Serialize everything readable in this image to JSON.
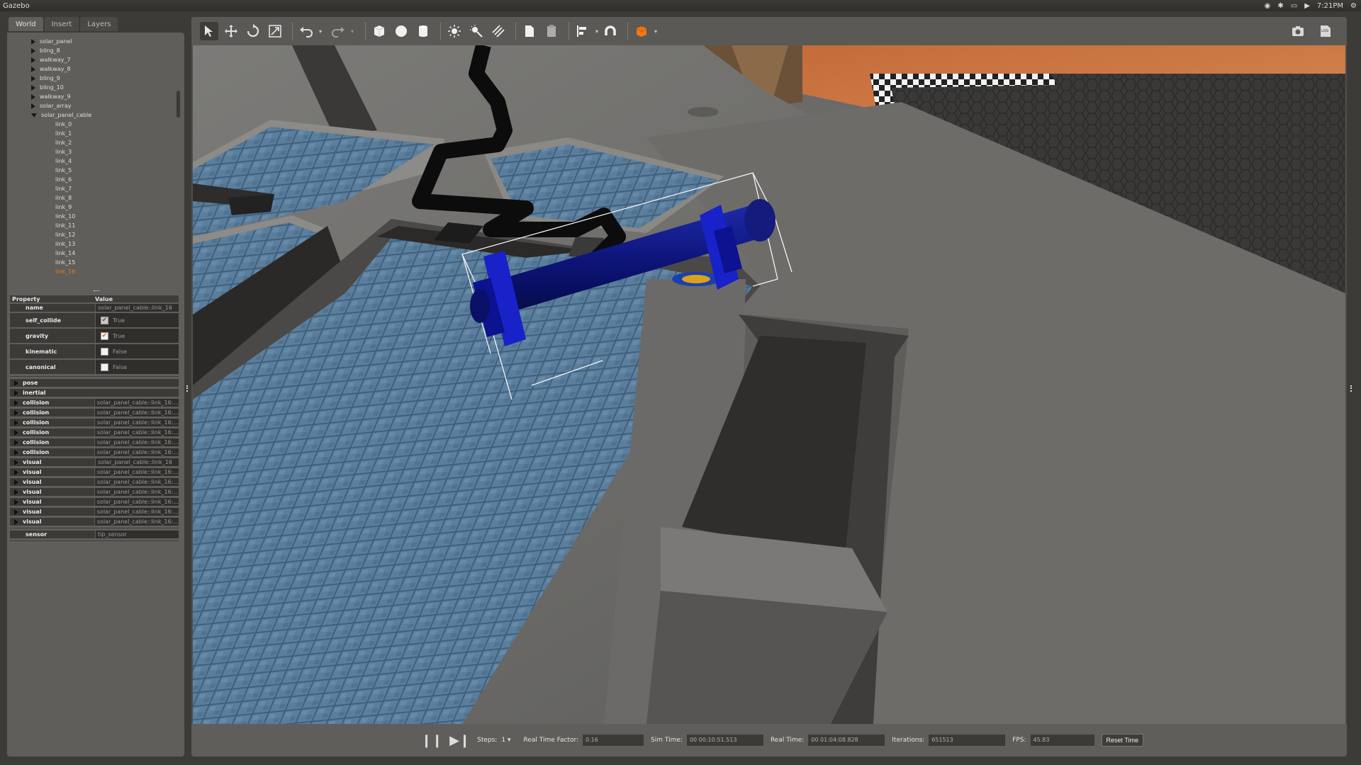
{
  "window": {
    "title": "Gazebo"
  },
  "system_tray": {
    "time": "7:21PM",
    "wifi": "wifi-icon",
    "bluetooth": "bluetooth-icon",
    "battery": "battery-icon",
    "volume": "volume-icon",
    "settings": "gear-icon"
  },
  "left_tabs": [
    {
      "label": "World"
    },
    {
      "label": "Insert"
    },
    {
      "label": "Layers"
    }
  ],
  "tree": {
    "items": [
      {
        "label": "solar_panel",
        "level": 1,
        "expanded": false
      },
      {
        "label": "bling_8",
        "level": 1,
        "expanded": false
      },
      {
        "label": "walkway_7",
        "level": 1,
        "expanded": false
      },
      {
        "label": "walkway_8",
        "level": 1,
        "expanded": false
      },
      {
        "label": "bling_9",
        "level": 1,
        "expanded": false
      },
      {
        "label": "bling_10",
        "level": 1,
        "expanded": false
      },
      {
        "label": "walkway_9",
        "level": 1,
        "expanded": false
      },
      {
        "label": "solar_array",
        "level": 1,
        "expanded": false
      },
      {
        "label": "solar_panel_cable",
        "level": 1,
        "expanded": true
      },
      {
        "label": "link_0",
        "level": 2
      },
      {
        "label": "link_1",
        "level": 2
      },
      {
        "label": "link_2",
        "level": 2
      },
      {
        "label": "link_3",
        "level": 2
      },
      {
        "label": "link_4",
        "level": 2
      },
      {
        "label": "link_5",
        "level": 2
      },
      {
        "label": "link_6",
        "level": 2
      },
      {
        "label": "link_7",
        "level": 2
      },
      {
        "label": "link_8",
        "level": 2
      },
      {
        "label": "link_9",
        "level": 2
      },
      {
        "label": "link_10",
        "level": 2
      },
      {
        "label": "link_11",
        "level": 2
      },
      {
        "label": "link_12",
        "level": 2
      },
      {
        "label": "link_13",
        "level": 2
      },
      {
        "label": "link_14",
        "level": 2
      },
      {
        "label": "link_15",
        "level": 2
      },
      {
        "label": "link_16",
        "level": 2,
        "selected": true
      }
    ]
  },
  "properties": {
    "header": {
      "property": "Property",
      "value": "Value"
    },
    "name": {
      "key": "name",
      "value": "solar_panel_cable::link_16"
    },
    "bools": [
      {
        "key": "self_collide",
        "value": "True",
        "checked": true,
        "style": "grey"
      },
      {
        "key": "gravity",
        "value": "True",
        "checked": true,
        "style": "orange"
      },
      {
        "key": "kinematic",
        "value": "False",
        "checked": false,
        "style": "white"
      },
      {
        "key": "canonical",
        "value": "False",
        "checked": false,
        "style": "white"
      }
    ],
    "groups": [
      {
        "key": "pose",
        "value": ""
      },
      {
        "key": "inertial",
        "value": ""
      },
      {
        "key": "collision",
        "value": "solar_panel_cable::link_16:..."
      },
      {
        "key": "collision",
        "value": "solar_panel_cable::link_16:..."
      },
      {
        "key": "collision",
        "value": "solar_panel_cable::link_16:..."
      },
      {
        "key": "collision",
        "value": "solar_panel_cable::link_16:..."
      },
      {
        "key": "collision",
        "value": "solar_panel_cable::link_16:..."
      },
      {
        "key": "collision",
        "value": "solar_panel_cable::link_16:..."
      },
      {
        "key": "visual",
        "value": "solar_panel_cable::link_16"
      },
      {
        "key": "visual",
        "value": "solar_panel_cable::link_16:..."
      },
      {
        "key": "visual",
        "value": "solar_panel_cable::link_16:..."
      },
      {
        "key": "visual",
        "value": "solar_panel_cable::link_16:..."
      },
      {
        "key": "visual",
        "value": "solar_panel_cable::link_16:..."
      },
      {
        "key": "visual",
        "value": "solar_panel_cable::link_16:..."
      },
      {
        "key": "visual",
        "value": "solar_panel_cable::link_16:..."
      }
    ],
    "sensor": {
      "key": "sensor",
      "value": "tip_sensor"
    }
  },
  "toolbar": {
    "tools": [
      "select-arrow-icon",
      "translate-icon",
      "rotate-icon",
      "scale-icon"
    ],
    "history": [
      "undo-icon",
      "redo-icon"
    ],
    "shapes": [
      "box-icon",
      "sphere-icon",
      "cylinder-icon"
    ],
    "lights": [
      "point-light-icon",
      "spot-light-icon",
      "directional-light-icon"
    ],
    "clipboard": [
      "copy-icon",
      "paste-icon"
    ],
    "align": [
      "align-icon",
      "snap-icon"
    ],
    "view": [
      "view-angle-icon"
    ],
    "right": [
      "screenshot-icon",
      "log-icon"
    ]
  },
  "bottom": {
    "steps_label": "Steps:",
    "steps_value": "1",
    "rtf_label": "Real Time Factor:",
    "rtf_value": "0.16",
    "sim_label": "Sim Time:",
    "sim_value": "00 00:10:51.513",
    "real_label": "Real Time:",
    "real_value": "00 01:04:08.828",
    "iter_label": "Iterations:",
    "iter_value": "651513",
    "fps_label": "FPS:",
    "fps_value": "45.83",
    "reset_label": "Reset Time"
  }
}
